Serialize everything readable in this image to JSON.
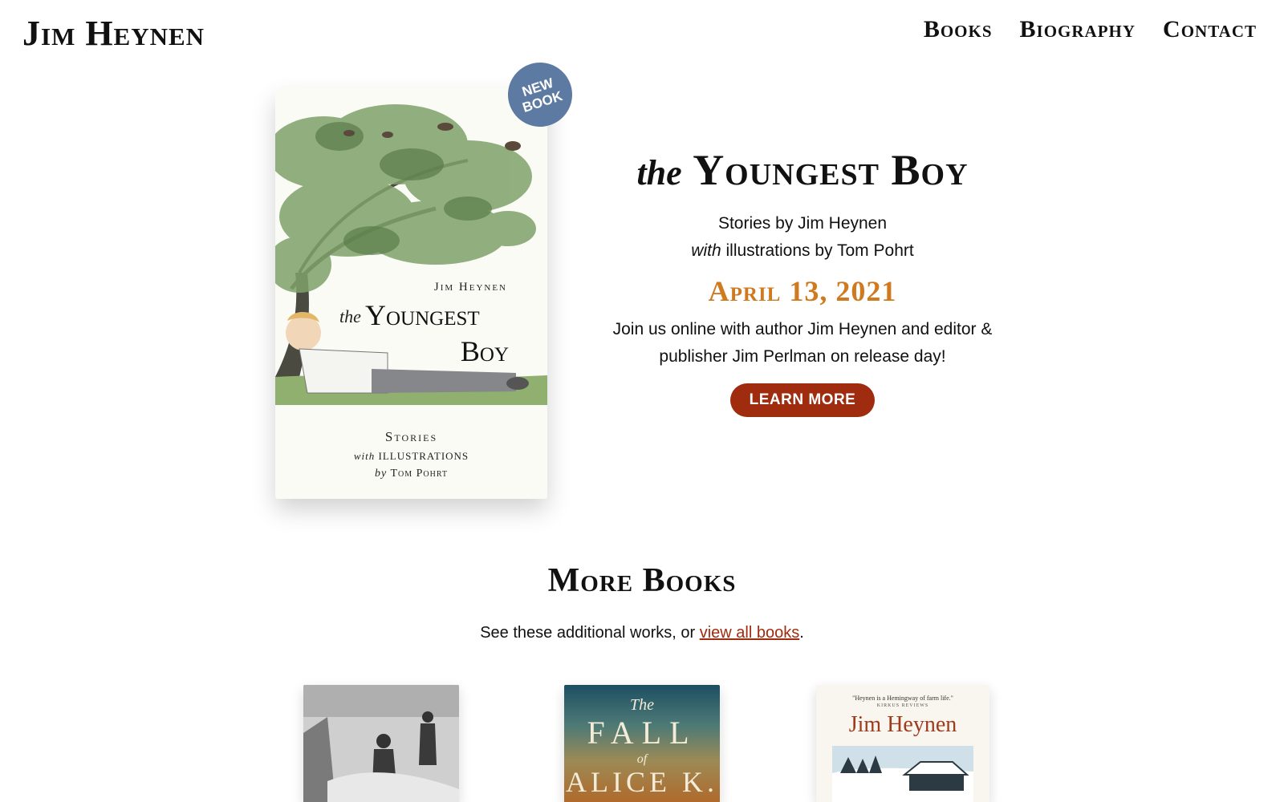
{
  "site": {
    "title": "Jim Heynen"
  },
  "nav": {
    "items": [
      {
        "label": "Books"
      },
      {
        "label": "Biography"
      },
      {
        "label": "Contact"
      }
    ]
  },
  "feature": {
    "badge_line1": "NEW",
    "badge_line2": "BOOK",
    "cover": {
      "author": "Jim Heynen",
      "title_the": "the",
      "title_line1": "Youngest",
      "title_line2": "Boy",
      "stories": "Stories",
      "with": "with",
      "illustrations": "ILLUSTRATIONS",
      "by": "by",
      "illustrator": "Tom Pohrt"
    },
    "title_the": "the",
    "title_main": "Youngest Boy",
    "byline_line1": "Stories by Jim Heynen",
    "byline_with": "with",
    "byline_rest": " illustrations by Tom Pohrt",
    "date": "April 13, 2021",
    "description": "Join us online with author Jim Heynen and editor & publisher Jim Perlman on release day!",
    "button_label": "LEARN MORE",
    "accent_color": "#d07a1f",
    "button_color": "#a02c0f",
    "badge_color": "#5d7ba2"
  },
  "more_books": {
    "title": "More Books",
    "desc_prefix": "See these additional works, or ",
    "link_label": "view all books",
    "desc_suffix": ".",
    "books": [
      {
        "text": []
      },
      {
        "text": [
          "The",
          "FALL",
          "of",
          "ALICE K."
        ]
      },
      {
        "text": [
          "\"Heynen is a Hemingway of farm life.\"",
          "KIRKUS REVIEWS",
          "Jim Heynen"
        ]
      }
    ]
  }
}
